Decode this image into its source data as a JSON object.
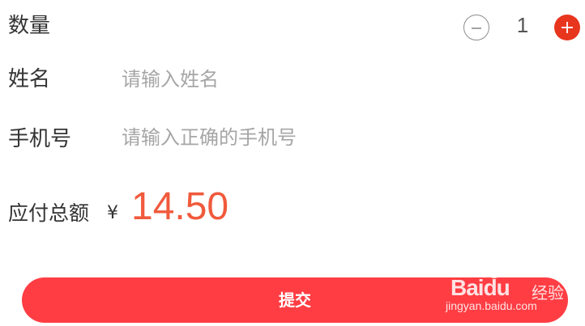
{
  "quantity": {
    "label": "数量",
    "value": "1"
  },
  "name_field": {
    "label": "姓名",
    "placeholder": "请输入姓名",
    "value": ""
  },
  "phone_field": {
    "label": "手机号",
    "placeholder": "请输入正确的手机号",
    "value": ""
  },
  "total": {
    "label": "应付总额",
    "currency": "¥",
    "amount": "14.50"
  },
  "submit": {
    "label": "提交"
  },
  "watermark": {
    "brand": "Baidu",
    "sub": "经验",
    "url": "jingyan.baidu.com"
  },
  "colors": {
    "accent": "#e8351e",
    "amount": "#f05a3c",
    "submit_bg": "#ff3d43",
    "placeholder": "#a6a6a6",
    "text": "#333333"
  },
  "icons": {
    "minus": "minus-circle-icon",
    "plus": "plus-circle-icon",
    "watermark_paw": "paw-icon"
  }
}
